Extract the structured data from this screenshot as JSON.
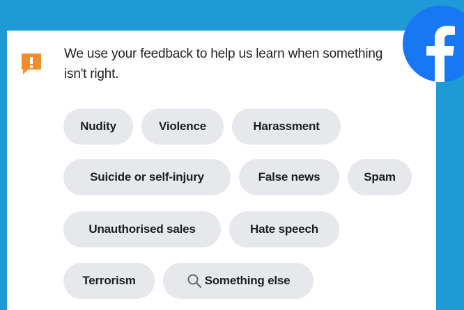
{
  "notice": {
    "text": "We use your feedback to help us learn when something isn't right."
  },
  "categories": [
    "Nudity",
    "Violence",
    "Harassment",
    "Suicide or self-injury",
    "False news",
    "Spam",
    "Unauthorised sales",
    "Hate speech",
    "Terrorism",
    "Something else"
  ],
  "colors": {
    "background": "#1e9ad6",
    "panel": "#ffffff",
    "chip": "#e7e8ec",
    "notice_icon": "#f28c28",
    "brand": "#1877f2"
  },
  "icons": {
    "notice": "alert-icon",
    "search": "search-icon",
    "brand": "facebook-logo-icon"
  }
}
